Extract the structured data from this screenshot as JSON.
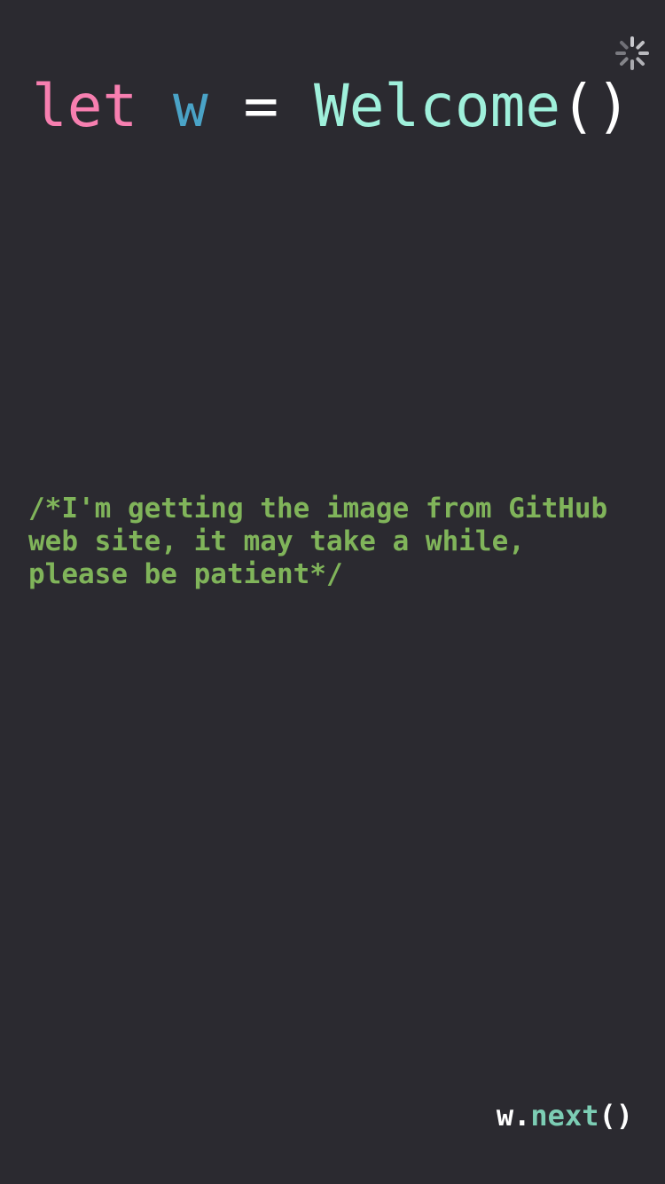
{
  "loading_indicator": {
    "icon": "activity-spinner-icon",
    "color": "#bdbdc3"
  },
  "title": {
    "keyword": "let",
    "variable": "w",
    "operator": "=",
    "type_name": "Welcome",
    "parens": "()"
  },
  "comment": {
    "line1": "/*I'm getting the image from GitHub",
    "line2": "web site, it may take a while,",
    "line3": "please be patient*/"
  },
  "next_button": {
    "object": "w",
    "dot": ".",
    "method": "next",
    "parens": "()"
  },
  "colors": {
    "background": "#2b2a30",
    "keyword": "#f77fb0",
    "variable": "#4aa3c7",
    "plain": "#ffffff",
    "type_name": "#9ff0db",
    "comment": "#80b45a",
    "method": "#7ccdb4"
  }
}
